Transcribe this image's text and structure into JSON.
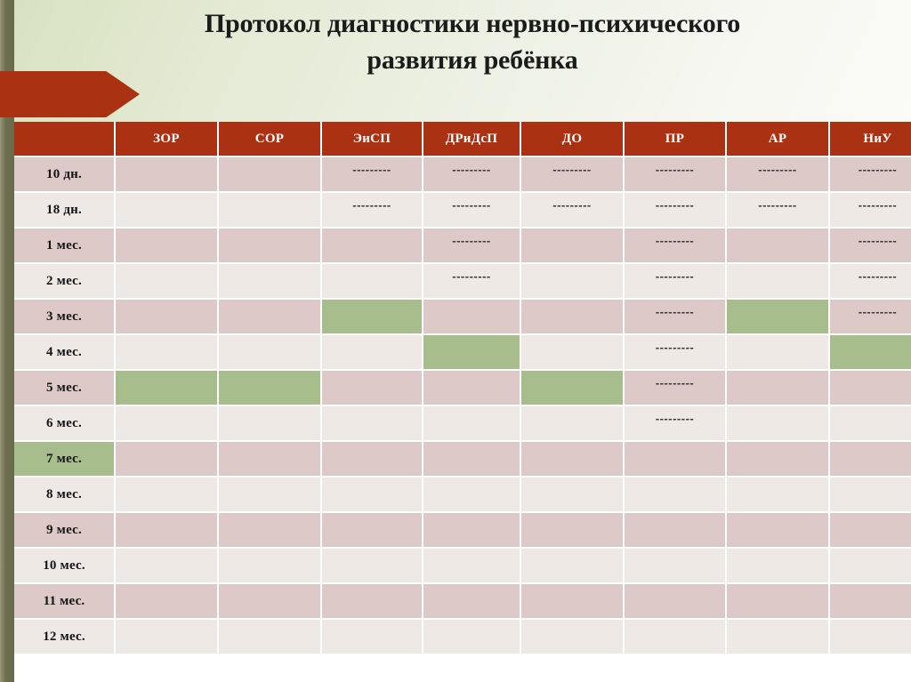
{
  "slide": {
    "title_lines": [
      "Протокол диагностики нервно-психического",
      "развития ребёнка"
    ],
    "colors": {
      "accent_red": "#ab3113",
      "olive_stripe": "#6e6d4f",
      "header_bg_green": "#d8e2c2",
      "cell_dark": "#ddcac8",
      "cell_light": "#efe9e6",
      "cell_green": "#a7bd8c"
    }
  },
  "table": {
    "corner_label": "",
    "columns": [
      "ЗОР",
      "СОР",
      "ЭиСП",
      "ДРиДсП",
      "ДО",
      "ПР",
      "АР",
      "НиУ"
    ],
    "dash_text": "---------",
    "rows": [
      {
        "label": "10 дн.",
        "label_shade": "dark",
        "cells": [
          {
            "shade": "dark",
            "text": ""
          },
          {
            "shade": "dark",
            "text": ""
          },
          {
            "shade": "dark",
            "text": "---------"
          },
          {
            "shade": "dark",
            "text": "---------"
          },
          {
            "shade": "dark",
            "text": "---------"
          },
          {
            "shade": "dark",
            "text": "---------"
          },
          {
            "shade": "dark",
            "text": "---------"
          },
          {
            "shade": "dark",
            "text": "---------"
          }
        ]
      },
      {
        "label": "18 дн.",
        "label_shade": "light",
        "cells": [
          {
            "shade": "light",
            "text": ""
          },
          {
            "shade": "light",
            "text": ""
          },
          {
            "shade": "light",
            "text": "---------"
          },
          {
            "shade": "light",
            "text": "---------"
          },
          {
            "shade": "light",
            "text": "---------"
          },
          {
            "shade": "light",
            "text": "---------"
          },
          {
            "shade": "light",
            "text": "---------"
          },
          {
            "shade": "light",
            "text": "---------"
          }
        ]
      },
      {
        "label": "1 мес.",
        "label_shade": "dark",
        "cells": [
          {
            "shade": "dark",
            "text": ""
          },
          {
            "shade": "dark",
            "text": ""
          },
          {
            "shade": "dark",
            "text": ""
          },
          {
            "shade": "dark",
            "text": "---------"
          },
          {
            "shade": "dark",
            "text": ""
          },
          {
            "shade": "dark",
            "text": "---------"
          },
          {
            "shade": "dark",
            "text": ""
          },
          {
            "shade": "dark",
            "text": "---------"
          }
        ]
      },
      {
        "label": "2 мес.",
        "label_shade": "light",
        "cells": [
          {
            "shade": "light",
            "text": ""
          },
          {
            "shade": "light",
            "text": ""
          },
          {
            "shade": "light",
            "text": ""
          },
          {
            "shade": "light",
            "text": "---------"
          },
          {
            "shade": "light",
            "text": ""
          },
          {
            "shade": "light",
            "text": "---------"
          },
          {
            "shade": "light",
            "text": ""
          },
          {
            "shade": "light",
            "text": "---------"
          }
        ]
      },
      {
        "label": "3 мес.",
        "label_shade": "dark",
        "cells": [
          {
            "shade": "dark",
            "text": ""
          },
          {
            "shade": "dark",
            "text": ""
          },
          {
            "shade": "green",
            "text": ""
          },
          {
            "shade": "dark",
            "text": ""
          },
          {
            "shade": "dark",
            "text": ""
          },
          {
            "shade": "dark",
            "text": "---------"
          },
          {
            "shade": "green",
            "text": ""
          },
          {
            "shade": "dark",
            "text": "---------"
          }
        ]
      },
      {
        "label": "4 мес.",
        "label_shade": "light",
        "cells": [
          {
            "shade": "light",
            "text": ""
          },
          {
            "shade": "light",
            "text": ""
          },
          {
            "shade": "light",
            "text": ""
          },
          {
            "shade": "green",
            "text": ""
          },
          {
            "shade": "light",
            "text": ""
          },
          {
            "shade": "light",
            "text": "---------"
          },
          {
            "shade": "light",
            "text": ""
          },
          {
            "shade": "green",
            "text": ""
          }
        ]
      },
      {
        "label": "5 мес.",
        "label_shade": "dark",
        "cells": [
          {
            "shade": "green",
            "text": ""
          },
          {
            "shade": "green",
            "text": ""
          },
          {
            "shade": "dark",
            "text": ""
          },
          {
            "shade": "dark",
            "text": ""
          },
          {
            "shade": "green",
            "text": ""
          },
          {
            "shade": "dark",
            "text": "---------"
          },
          {
            "shade": "dark",
            "text": ""
          },
          {
            "shade": "dark",
            "text": ""
          }
        ]
      },
      {
        "label": "6 мес.",
        "label_shade": "light",
        "cells": [
          {
            "shade": "light",
            "text": ""
          },
          {
            "shade": "light",
            "text": ""
          },
          {
            "shade": "light",
            "text": ""
          },
          {
            "shade": "light",
            "text": ""
          },
          {
            "shade": "light",
            "text": ""
          },
          {
            "shade": "light",
            "text": "---------"
          },
          {
            "shade": "light",
            "text": ""
          },
          {
            "shade": "light",
            "text": ""
          }
        ]
      },
      {
        "label": "7 мес.",
        "label_shade": "green",
        "cells": [
          {
            "shade": "dark",
            "text": ""
          },
          {
            "shade": "dark",
            "text": ""
          },
          {
            "shade": "dark",
            "text": ""
          },
          {
            "shade": "dark",
            "text": ""
          },
          {
            "shade": "dark",
            "text": ""
          },
          {
            "shade": "dark",
            "text": ""
          },
          {
            "shade": "dark",
            "text": ""
          },
          {
            "shade": "dark",
            "text": ""
          }
        ]
      },
      {
        "label": "8 мес.",
        "label_shade": "light",
        "cells": [
          {
            "shade": "light",
            "text": ""
          },
          {
            "shade": "light",
            "text": ""
          },
          {
            "shade": "light",
            "text": ""
          },
          {
            "shade": "light",
            "text": ""
          },
          {
            "shade": "light",
            "text": ""
          },
          {
            "shade": "light",
            "text": ""
          },
          {
            "shade": "light",
            "text": ""
          },
          {
            "shade": "light",
            "text": ""
          }
        ]
      },
      {
        "label": "9 мес.",
        "label_shade": "dark",
        "cells": [
          {
            "shade": "dark",
            "text": ""
          },
          {
            "shade": "dark",
            "text": ""
          },
          {
            "shade": "dark",
            "text": ""
          },
          {
            "shade": "dark",
            "text": ""
          },
          {
            "shade": "dark",
            "text": ""
          },
          {
            "shade": "dark",
            "text": ""
          },
          {
            "shade": "dark",
            "text": ""
          },
          {
            "shade": "dark",
            "text": ""
          }
        ]
      },
      {
        "label": "10 мес.",
        "label_shade": "light",
        "cells": [
          {
            "shade": "light",
            "text": ""
          },
          {
            "shade": "light",
            "text": ""
          },
          {
            "shade": "light",
            "text": ""
          },
          {
            "shade": "light",
            "text": ""
          },
          {
            "shade": "light",
            "text": ""
          },
          {
            "shade": "light",
            "text": ""
          },
          {
            "shade": "light",
            "text": ""
          },
          {
            "shade": "light",
            "text": ""
          }
        ]
      },
      {
        "label": "11 мес.",
        "label_shade": "dark",
        "cells": [
          {
            "shade": "dark",
            "text": ""
          },
          {
            "shade": "dark",
            "text": ""
          },
          {
            "shade": "dark",
            "text": ""
          },
          {
            "shade": "dark",
            "text": ""
          },
          {
            "shade": "dark",
            "text": ""
          },
          {
            "shade": "dark",
            "text": ""
          },
          {
            "shade": "dark",
            "text": ""
          },
          {
            "shade": "dark",
            "text": ""
          }
        ]
      },
      {
        "label": "12 мес.",
        "label_shade": "light",
        "cells": [
          {
            "shade": "light",
            "text": ""
          },
          {
            "shade": "light",
            "text": ""
          },
          {
            "shade": "light",
            "text": ""
          },
          {
            "shade": "light",
            "text": ""
          },
          {
            "shade": "light",
            "text": ""
          },
          {
            "shade": "light",
            "text": ""
          },
          {
            "shade": "light",
            "text": ""
          },
          {
            "shade": "light",
            "text": ""
          }
        ]
      }
    ]
  }
}
